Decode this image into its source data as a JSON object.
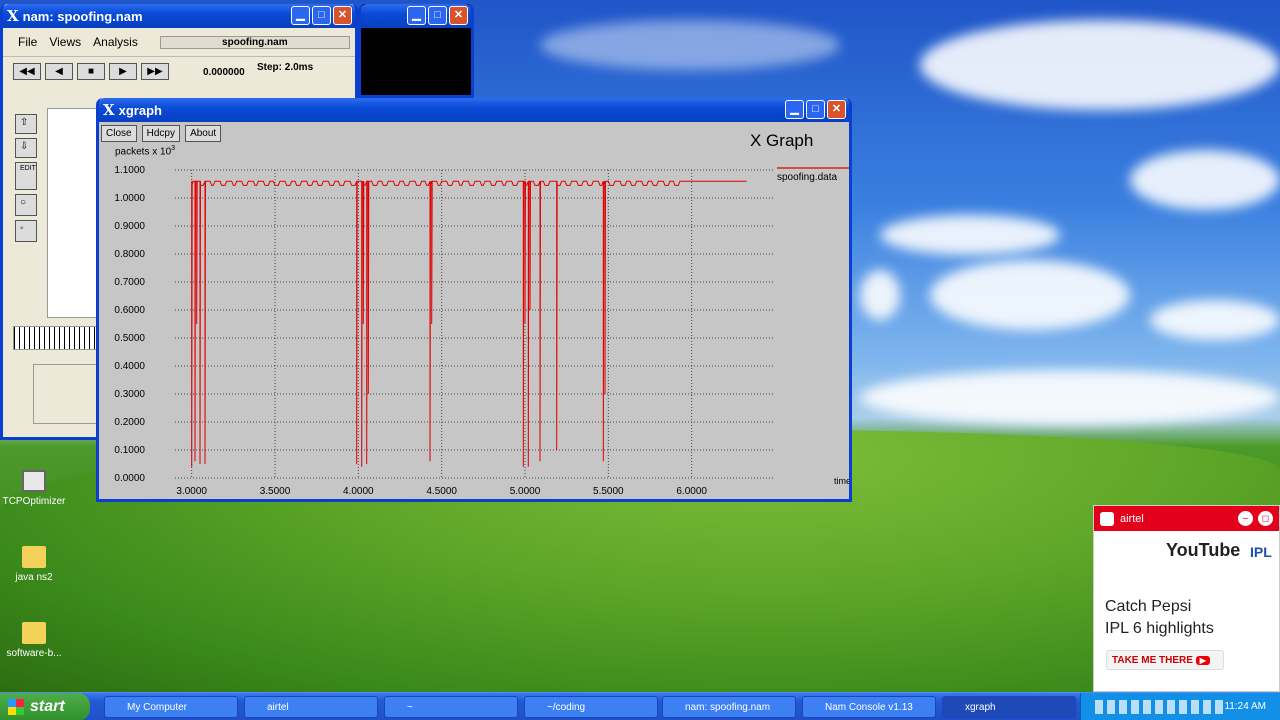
{
  "nam": {
    "title": "nam: spoofing.nam",
    "menus": [
      "File",
      "Views",
      "Analysis"
    ],
    "file_label": "spoofing.nam",
    "time_value": "0.000000",
    "step_label": "Step: 2.0ms"
  },
  "xgraph": {
    "title": "xgraph",
    "buttons": [
      "Close",
      "Hdcpy",
      "About"
    ],
    "graph_title": "X Graph",
    "y_axis_label": "packets x 10",
    "y_axis_exponent": "3",
    "x_axis_label": "time",
    "legend": "spoofing.data"
  },
  "chart_data": {
    "type": "line",
    "series": [
      {
        "name": "spoofing.data",
        "color": "#e00000"
      }
    ],
    "xlabel": "time",
    "ylabel": "packets x 10^3",
    "xlim": [
      2.9,
      6.5
    ],
    "ylim": [
      0.0,
      1.1
    ],
    "x_ticks": [
      "3.0000",
      "3.5000",
      "4.0000",
      "4.5000",
      "5.0000",
      "5.5000",
      "6.0000"
    ],
    "y_ticks": [
      "0.0000",
      "0.1000",
      "0.2000",
      "0.3000",
      "0.4000",
      "0.5000",
      "0.6000",
      "0.7000",
      "0.8000",
      "0.9000",
      "1.0000",
      "1.1000"
    ],
    "baseline": 1.06,
    "x_end": 6.33,
    "drops": [
      {
        "x": 3.0,
        "y": 0.04
      },
      {
        "x": 3.02,
        "y": 0.06
      },
      {
        "x": 3.03,
        "y": 0.55
      },
      {
        "x": 3.05,
        "y": 0.05
      },
      {
        "x": 3.08,
        "y": 0.05
      },
      {
        "x": 3.99,
        "y": 0.05
      },
      {
        "x": 4.02,
        "y": 0.04
      },
      {
        "x": 4.03,
        "y": 0.55
      },
      {
        "x": 4.05,
        "y": 0.05
      },
      {
        "x": 4.06,
        "y": 0.3
      },
      {
        "x": 4.43,
        "y": 0.06
      },
      {
        "x": 4.44,
        "y": 0.55
      },
      {
        "x": 4.99,
        "y": 0.04
      },
      {
        "x": 5.0,
        "y": 0.55
      },
      {
        "x": 5.02,
        "y": 0.04
      },
      {
        "x": 5.03,
        "y": 0.6
      },
      {
        "x": 5.09,
        "y": 0.06
      },
      {
        "x": 5.19,
        "y": 0.1
      },
      {
        "x": 5.47,
        "y": 0.06
      },
      {
        "x": 5.48,
        "y": 0.3
      }
    ]
  },
  "desktop": {
    "icons": [
      "TCPOptimizer",
      "java ns2",
      "software-b..."
    ]
  },
  "ad": {
    "brand": "airtel",
    "youtube": "YouTube",
    "ipl": "IPL",
    "line1": "Catch Pepsi",
    "line2": "IPL 6 highlights",
    "cta": "TAKE ME THERE"
  },
  "taskbar": {
    "start": "start",
    "tasks": [
      "My Computer",
      "airtel",
      "~",
      "~/coding",
      "nam: spoofing.nam",
      "Nam Console v1.13",
      "xgraph"
    ],
    "clock": "11:24 AM"
  }
}
